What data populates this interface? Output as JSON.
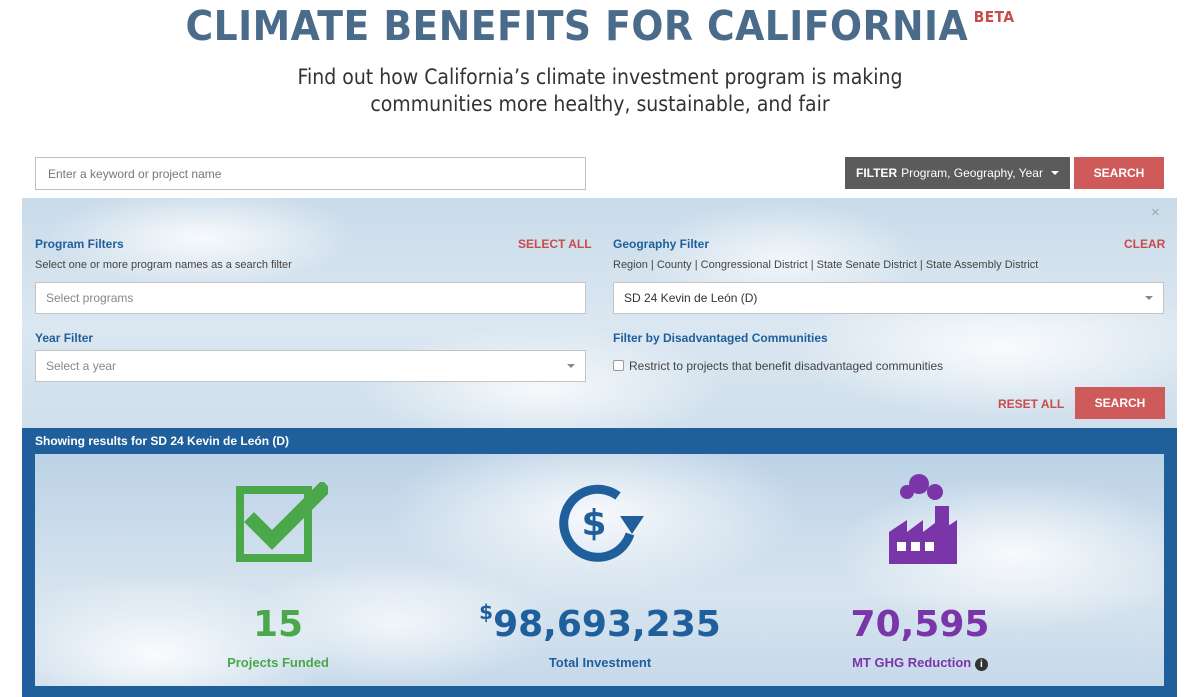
{
  "header": {
    "title": "CLIMATE BENEFITS FOR CALIFORNIA",
    "badge": "BETA",
    "subtitle": "Find out how California’s climate investment program is making communities more healthy, sustainable, and fair"
  },
  "search": {
    "placeholder": "Enter a keyword or project name",
    "filter_button_bold": "FILTER",
    "filter_button_rest": "Program, Geography, Year",
    "search_label": "SEARCH"
  },
  "filters": {
    "close": "×",
    "program": {
      "label": "Program Filters",
      "select_all": "SELECT ALL",
      "hint": "Select one or more program names as a search filter",
      "placeholder": "Select programs"
    },
    "geography": {
      "label": "Geography Filter",
      "clear": "CLEAR",
      "hint": "Region | County | Congressional District | State Senate District | State Assembly District",
      "value": "SD 24 Kevin de León (D)"
    },
    "year": {
      "label": "Year Filter",
      "placeholder": "Select a year"
    },
    "disadvantaged": {
      "label": "Filter by Disadvantaged Communities",
      "checkbox_label": "Restrict to projects that benefit disadvantaged communities"
    },
    "reset_all": "RESET ALL",
    "search_label": "SEARCH"
  },
  "results": {
    "label": "Showing results for SD 24 Kevin de León (D)",
    "stats": [
      {
        "value": "15",
        "caption": "Projects Funded",
        "color": "#4aa84a",
        "icon": "checkbox-check-icon"
      },
      {
        "prefix": "$",
        "value": "98,693,235",
        "caption": "Total Investment",
        "color": "#1f5f9b",
        "icon": "dollar-cycle-icon"
      },
      {
        "value": "70,595",
        "caption": "MT GHG Reduction",
        "color": "#7a35a8",
        "icon": "factory-icon",
        "info": "i"
      }
    ]
  }
}
